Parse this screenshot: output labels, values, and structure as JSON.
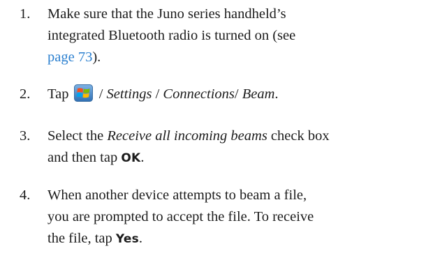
{
  "steps": [
    {
      "number": "1.",
      "lead": "Make sure that the Juno series handheld’s",
      "line2": "integrated Bluetooth radio is turned on (see",
      "link": "page 73",
      "tail": ")."
    },
    {
      "number": "2.",
      "prefix": "Tap",
      "icon": "windows-start-icon",
      "sep1": "/",
      "nav1": "Settings",
      "sep2": "/",
      "nav2": "Connections",
      "sep3": "/",
      "nav3": "Beam",
      "end": "."
    },
    {
      "number": "3.",
      "pre": "Select the",
      "checkbox_name": "Receive all incoming beams",
      "mid": "check box",
      "line2": "and then tap",
      "button": "OK",
      "end": "."
    },
    {
      "number": "4.",
      "line1": "When another device attempts to beam a file,",
      "line2": "you are prompted to accept the file. To receive",
      "line3": "the file, tap",
      "button": "Yes",
      "end": "."
    }
  ],
  "colors": {
    "text": "#1c1c1c",
    "link": "#2a7fcf"
  }
}
